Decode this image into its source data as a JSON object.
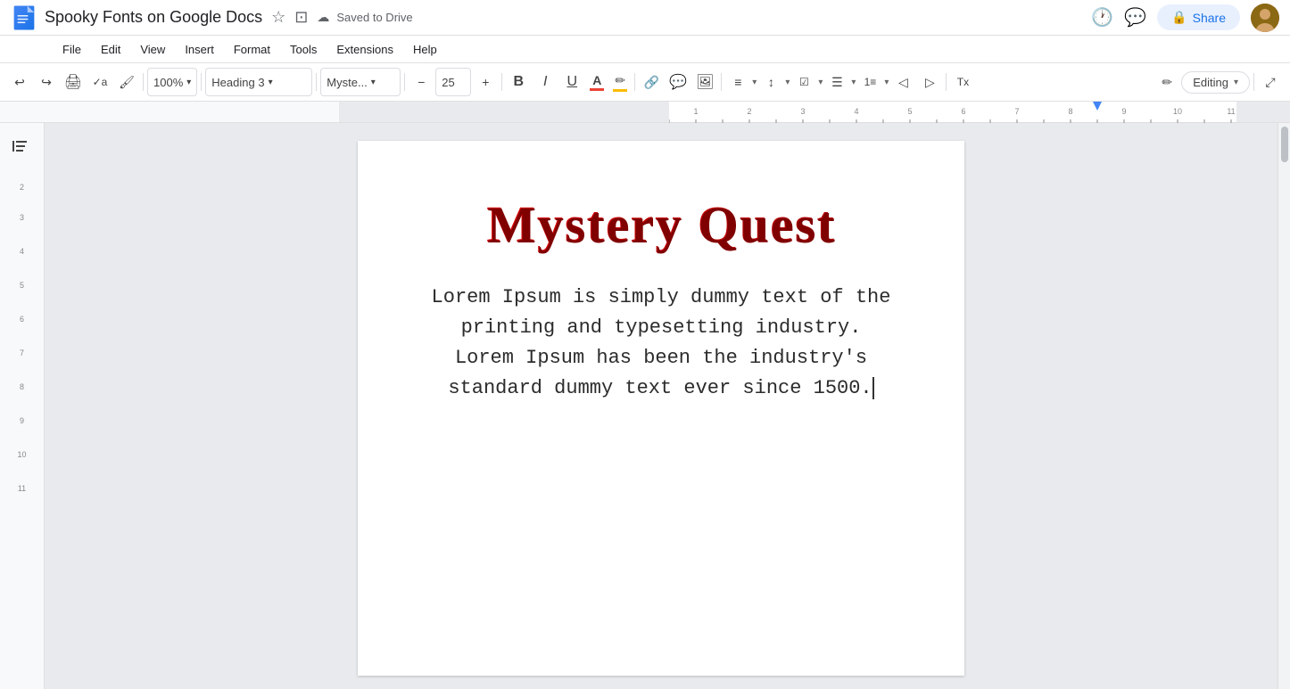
{
  "titlebar": {
    "doc_icon_color": "#1a73e8",
    "title": "Spooky Fonts on Google Docs",
    "star_icon": "☆",
    "folder_icon": "⊡",
    "cloud_icon": "☁",
    "saved_status": "Saved to Drive",
    "history_icon": "🕐",
    "comment_icon": "💬",
    "share_btn_label": "Share",
    "lock_icon": "🔒"
  },
  "menubar": {
    "items": [
      "File",
      "Edit",
      "View",
      "Insert",
      "Format",
      "Tools",
      "Extensions",
      "Help"
    ]
  },
  "toolbar": {
    "undo_icon": "↩",
    "redo_icon": "↪",
    "print_icon": "🖨",
    "paint_format_icon": "✏",
    "zoom_level": "100%",
    "style_select": "Heading 3",
    "font_select": "Myste...",
    "font_size_minus": "−",
    "font_size": "25",
    "font_size_plus": "+",
    "bold_label": "B",
    "italic_label": "I",
    "underline_label": "U",
    "font_color_label": "A",
    "highlight_label": "✏",
    "link_icon": "🔗",
    "comment_icon": "💬",
    "image_icon": "🖼",
    "align_icon": "≡",
    "line_spacing_icon": "↕",
    "list_icon": "☰",
    "numbered_list_icon": "≡",
    "indent_less_icon": "◁",
    "indent_more_icon": "▷",
    "clear_format_icon": "Tx",
    "editing_mode": "Editing",
    "expand_icon": "⤢"
  },
  "outline": {
    "icon": "☰"
  },
  "document": {
    "heading": "Mystery Quest",
    "body": "Lorem Ipsum is simply dummy text of the printing and typesetting industry. Lorem Ipsum has been the industry's standard dummy text ever since 1500."
  }
}
